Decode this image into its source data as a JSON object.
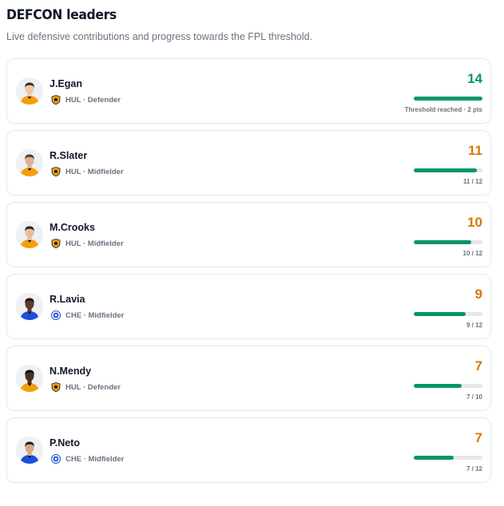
{
  "header": {
    "title": "DEFCON leaders",
    "subtitle": "Live defensive contributions and progress towards the FPL threshold."
  },
  "colors": {
    "accent_green": "#059669",
    "accent_orange": "#d97706",
    "bar_track": "#e5e7eb",
    "hul_kit": "#f59e0b",
    "che_kit": "#1d4ed8"
  },
  "players": [
    {
      "name": "J.Egan",
      "team": "HUL",
      "position": "Defender",
      "meta": "HUL · Defender",
      "value": "14",
      "progress": 1.0,
      "status": "reached",
      "caption": "Threshold reached · 2 pts",
      "crest_icon": "hull-crest-icon",
      "avatar_icon": "player-avatar-icon"
    },
    {
      "name": "R.Slater",
      "team": "HUL",
      "position": "Midfielder",
      "meta": "HUL · Midfielder",
      "value": "11",
      "progress": 0.9167,
      "status": "progress",
      "caption": "11 / 12",
      "crest_icon": "hull-crest-icon",
      "avatar_icon": "player-avatar-icon"
    },
    {
      "name": "M.Crooks",
      "team": "HUL",
      "position": "Midfielder",
      "meta": "HUL · Midfielder",
      "value": "10",
      "progress": 0.8333,
      "status": "progress",
      "caption": "10 / 12",
      "crest_icon": "hull-crest-icon",
      "avatar_icon": "player-avatar-icon"
    },
    {
      "name": "R.Lavia",
      "team": "CHE",
      "position": "Midfielder",
      "meta": "CHE · Midfielder",
      "value": "9",
      "progress": 0.75,
      "status": "progress",
      "caption": "9 / 12",
      "crest_icon": "chelsea-crest-icon",
      "avatar_icon": "player-avatar-icon"
    },
    {
      "name": "N.Mendy",
      "team": "HUL",
      "position": "Defender",
      "meta": "HUL · Defender",
      "value": "7",
      "progress": 0.7,
      "status": "progress",
      "caption": "7 / 10",
      "crest_icon": "hull-crest-icon",
      "avatar_icon": "player-avatar-icon"
    },
    {
      "name": "P.Neto",
      "team": "CHE",
      "position": "Midfielder",
      "meta": "CHE · Midfielder",
      "value": "7",
      "progress": 0.5833,
      "status": "progress",
      "caption": "7 / 12",
      "crest_icon": "chelsea-crest-icon",
      "avatar_icon": "player-avatar-icon"
    }
  ]
}
